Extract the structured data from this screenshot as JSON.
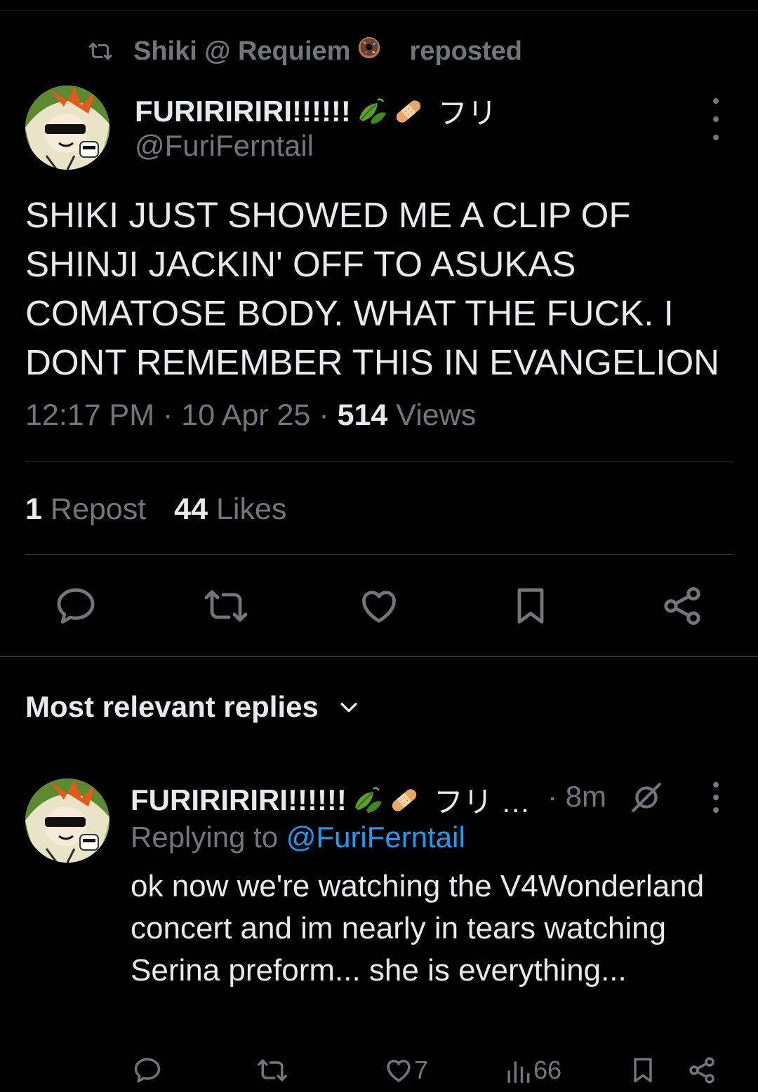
{
  "repost_banner": {
    "reposter": "Shiki @ Requiem",
    "reposted_label": "reposted"
  },
  "post": {
    "author_name": "FURIRIRIRI!!!!!!",
    "author_suffix": "フリ",
    "handle": "@FuriFerntail",
    "text": "SHIKI JUST SHOWED ME A CLIP OF SHINJI JACKIN' OFF TO ASUKAS COMATOSE BODY. WHAT THE FUCK. I DONT REMEMBER THIS IN EVANGELION",
    "time": "12:17 PM",
    "date": "10 Apr 25",
    "views_count": "514",
    "views_label": "Views",
    "reposts_count": "1",
    "reposts_label": "Repost",
    "likes_count": "44",
    "likes_label": "Likes",
    "icons": [
      "reply-icon",
      "repost-icon",
      "like-icon",
      "bookmark-icon",
      "share-icon"
    ]
  },
  "replies_section": {
    "sort_label": "Most relevant replies"
  },
  "reply": {
    "author_name": "FURIRIRIRI!!!!!!",
    "author_suffix": "フリ …",
    "time": "· 8m",
    "replying_prefix": "Replying to",
    "replying_mention": "@FuriFerntail",
    "text": "ok now we're watching the V4Wonderland concert and im nearly in tears watching Serina preform... she is everything...",
    "like_count": "7",
    "views_count": "66",
    "icons": [
      "reply-icon",
      "repost-icon",
      "like-icon",
      "views-icon",
      "bookmark-icon",
      "share-icon"
    ]
  },
  "colors": {
    "background": "#000000",
    "text_primary": "#e7e9ea",
    "text_secondary": "#71767b",
    "link": "#1d9bf0",
    "divider": "#2f3336"
  }
}
